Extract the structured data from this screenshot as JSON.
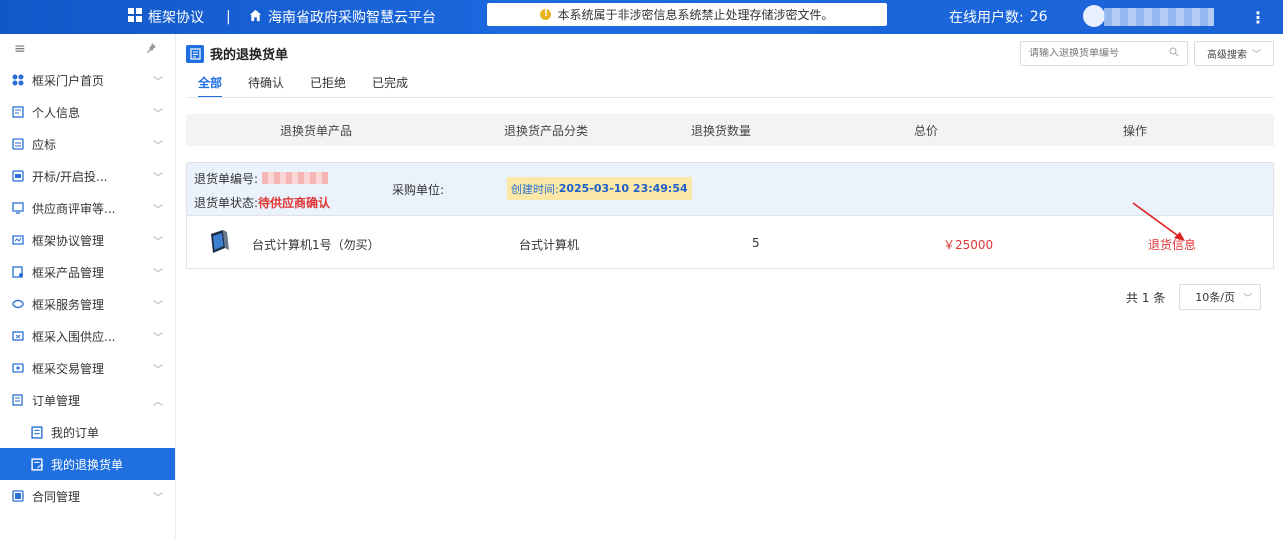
{
  "topbar": {
    "brand": "框架协议",
    "separator": "|",
    "platform": "海南省政府采购智慧云平台",
    "notice": "本系统属于非涉密信息系统禁止处理存储涉密文件。",
    "online_label": "在线用户数:",
    "online_count": "26"
  },
  "sidebar": {
    "items": [
      {
        "label": "框采门户首页",
        "icon": "cluster-icon"
      },
      {
        "label": "个人信息",
        "icon": "profile-icon"
      },
      {
        "label": "应标",
        "icon": "bid-icon"
      },
      {
        "label": "开标/开启投...",
        "icon": "open-bid-icon"
      },
      {
        "label": "供应商评审等...",
        "icon": "review-icon"
      },
      {
        "label": "框架协议管理",
        "icon": "agreement-icon"
      },
      {
        "label": "框采产品管理",
        "icon": "product-icon"
      },
      {
        "label": "框采服务管理",
        "icon": "service-icon"
      },
      {
        "label": "框采入围供应...",
        "icon": "supplier-icon"
      },
      {
        "label": "框采交易管理",
        "icon": "trade-icon"
      },
      {
        "label": "订单管理",
        "icon": "order-icon"
      }
    ],
    "sub_items": [
      {
        "label": "我的订单"
      },
      {
        "label": "我的退换货单"
      }
    ],
    "last_item": {
      "label": "合同管理"
    }
  },
  "page": {
    "title": "我的退换货单",
    "search_placeholder": "请输入退换货单编号",
    "advanced_search": "高级搜索",
    "tabs": [
      "全部",
      "待确认",
      "已拒绝",
      "已完成"
    ],
    "columns": [
      "退换货单产品",
      "退换货产品分类",
      "退换货数量",
      "总价",
      "操作"
    ]
  },
  "order": {
    "no_label": "退货单编号:",
    "status_label": "退货单状态:",
    "status_value": "待供应商确认",
    "buyer_label": "采购单位:",
    "created_label": "创建时间:",
    "created_value": "2025-03-10 23:49:54",
    "product_name": "台式计算机1号（勿买）",
    "category": "台式计算机",
    "quantity": "5",
    "total": "￥25000",
    "action": "退货信息"
  },
  "pager": {
    "total": "共 1 条",
    "page_size": "10条/页"
  }
}
